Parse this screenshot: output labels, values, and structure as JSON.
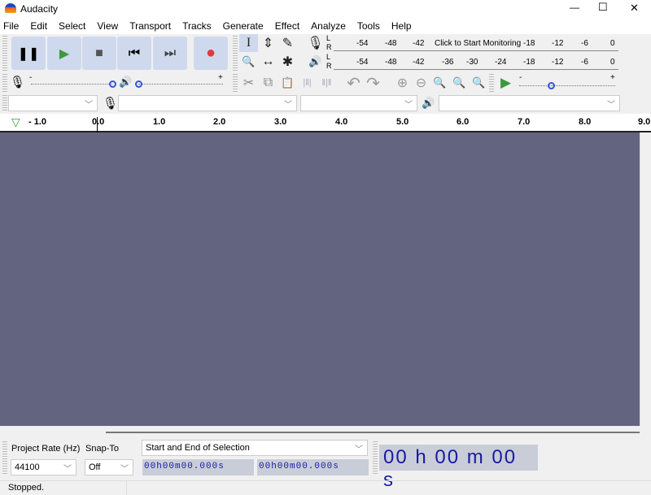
{
  "window": {
    "title": "Audacity",
    "minimize": "—",
    "maximize": "☐",
    "close": "✕"
  },
  "menu": [
    "File",
    "Edit",
    "Select",
    "View",
    "Transport",
    "Tracks",
    "Generate",
    "Effect",
    "Analyze",
    "Tools",
    "Help"
  ],
  "transport": {
    "pause": "❚❚",
    "play": "▶",
    "stop": "■",
    "skip_start": "⏮",
    "skip_end": "⏭",
    "record": "●"
  },
  "tools": {
    "select": "I",
    "envelope": "⇕",
    "draw": "✎",
    "zoom": "🔍",
    "timeshift": "↔",
    "multi": "✱"
  },
  "meters": {
    "record_ticks": [
      "-54",
      "-48",
      "-42",
      "-18",
      "-12",
      "-6",
      "0"
    ],
    "monitor_label": "Click to Start Monitoring",
    "play_ticks": [
      "-54",
      "-48",
      "-42",
      "-36",
      "-30",
      "-24",
      "-18",
      "-12",
      "-6",
      "0"
    ],
    "L": "L",
    "R": "R"
  },
  "mixer": {
    "minus": "-",
    "plus": "+",
    "record_volume": 1.0,
    "playback_volume": 0.0,
    "play_speed": 0.5
  },
  "edit": {
    "cut": "✂",
    "copy": "⧉",
    "paste": "📋",
    "undo": "↶",
    "redo": "↷",
    "zoom_in": "⊕",
    "zoom_out": "⊖"
  },
  "devices": {
    "host": "",
    "recording_device": "",
    "channels": "",
    "playback_device": ""
  },
  "ruler": {
    "ticks": [
      "- 1.0",
      "0.0",
      "1.0",
      "2.0",
      "3.0",
      "4.0",
      "5.0",
      "6.0",
      "7.0",
      "8.0",
      "9.0"
    ]
  },
  "selection_bar": {
    "project_rate_label": "Project Rate (Hz)",
    "project_rate": "44100",
    "snap_label": "Snap-To",
    "snap": "Off",
    "selection_mode": "Start and End of Selection",
    "start": "00h00m00.000s",
    "end": "00h00m00.000s"
  },
  "audio_position": "00 h 00 m 00 s",
  "status": "Stopped.",
  "colors": {
    "track_bg": "#63647f",
    "button_bg": "#cfd9ee",
    "record": "#e0393e",
    "play": "#3c9a3c"
  }
}
